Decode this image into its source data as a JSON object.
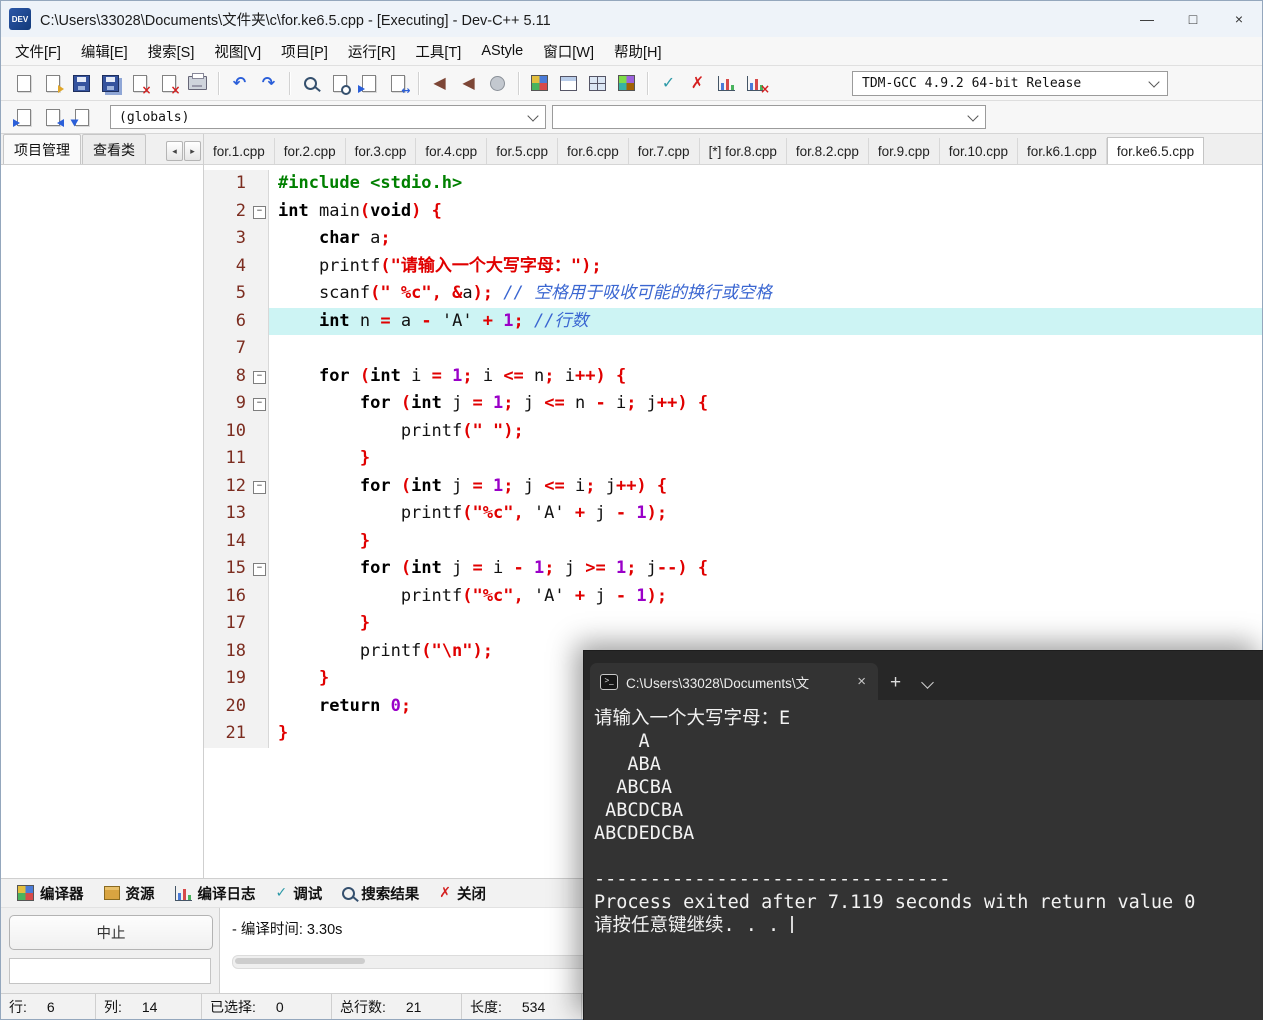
{
  "window": {
    "title": "C:\\Users\\33028\\Documents\\文件夹\\c\\for.ke6.5.cpp - [Executing] - Dev-C++ 5.11",
    "logo": "DEV",
    "min": "—",
    "max": "□",
    "close": "×"
  },
  "menu": {
    "items": [
      {
        "id": "file",
        "label": "文件[F]"
      },
      {
        "id": "edit",
        "label": "编辑[E]"
      },
      {
        "id": "search",
        "label": "搜索[S]"
      },
      {
        "id": "view",
        "label": "视图[V]"
      },
      {
        "id": "project",
        "label": "项目[P]"
      },
      {
        "id": "execute",
        "label": "运行[R]"
      },
      {
        "id": "tools",
        "label": "工具[T]"
      },
      {
        "id": "astyle",
        "label": "AStyle"
      },
      {
        "id": "window",
        "label": "窗口[W]"
      },
      {
        "id": "help",
        "label": "帮助[H]"
      }
    ]
  },
  "toolbar": {
    "compiler": "TDM-GCC 4.9.2 64-bit Release",
    "buttons": [
      {
        "name": "new-file",
        "icon": "new"
      },
      {
        "name": "open-file",
        "icon": "open"
      },
      {
        "name": "save",
        "icon": "save"
      },
      {
        "name": "save-all",
        "icon": "saveall"
      },
      {
        "name": "close-file",
        "icon": "close"
      },
      {
        "name": "close-all",
        "icon": "closeall"
      },
      {
        "name": "print",
        "icon": "print"
      },
      {
        "sep": true
      },
      {
        "name": "undo",
        "icon": "undo"
      },
      {
        "name": "redo",
        "icon": "redo"
      },
      {
        "sep": true
      },
      {
        "name": "find",
        "icon": "find"
      },
      {
        "name": "find-in-files",
        "icon": "findfiles"
      },
      {
        "name": "goto-line",
        "icon": "goto"
      },
      {
        "name": "replace",
        "icon": "replace"
      },
      {
        "sep": true
      },
      {
        "name": "compile",
        "icon": "compile"
      },
      {
        "name": "run",
        "icon": "run"
      },
      {
        "name": "profile",
        "icon": "pause"
      },
      {
        "sep": true
      },
      {
        "name": "new-project",
        "icon": "gridcolor"
      },
      {
        "name": "window-layout",
        "icon": "windowoutline"
      },
      {
        "name": "split-view",
        "icon": "gridpanes"
      },
      {
        "name": "project-options",
        "icon": "gridcolor2"
      },
      {
        "sep": true
      },
      {
        "name": "syntax-check",
        "icon": "check"
      },
      {
        "name": "abort-compile",
        "icon": "cross"
      },
      {
        "name": "profile-analysis",
        "icon": "chart"
      },
      {
        "name": "delete-profile",
        "icon": "chartx"
      }
    ]
  },
  "navbar": {
    "buttons": [
      {
        "name": "nav-back",
        "icon": "navback"
      },
      {
        "name": "nav-forward",
        "icon": "navforward"
      },
      {
        "name": "nav-goto",
        "icon": "navgoto"
      }
    ],
    "globals": "(globals)",
    "members": ""
  },
  "left_panel": {
    "tabs": [
      {
        "id": "project-manager",
        "label": "项目管理",
        "active": true
      },
      {
        "id": "class-viewer",
        "label": "查看类",
        "active": false
      }
    ],
    "scroll_left": "◂",
    "scroll_right": "▸"
  },
  "doc_tabs": {
    "active": "for.ke6.5.cpp",
    "tabs": [
      "for.1.cpp",
      "for.2.cpp",
      "for.3.cpp",
      "for.4.cpp",
      "for.5.cpp",
      "for.6.cpp",
      "for.7.cpp",
      "[*] for.8.cpp",
      "for.8.2.cpp",
      "for.9.cpp",
      "for.10.cpp",
      "for.k6.1.cpp",
      "for.ke6.5.cpp"
    ]
  },
  "editor": {
    "lines": [
      {
        "tokens": [
          [
            "p",
            "#include <stdio.h>"
          ]
        ]
      },
      {
        "fold": true,
        "tokens": [
          [
            "k",
            "int"
          ],
          [
            "",
            " main"
          ],
          [
            "o",
            "("
          ],
          [
            "k",
            "void"
          ],
          [
            "o",
            ")"
          ],
          [
            "",
            " "
          ],
          [
            "o",
            "{"
          ]
        ]
      },
      {
        "tokens": [
          [
            "",
            "    "
          ],
          [
            "k",
            "char"
          ],
          [
            "",
            " a"
          ],
          [
            "o",
            ";"
          ]
        ]
      },
      {
        "tokens": [
          [
            "",
            "    printf"
          ],
          [
            "o",
            "("
          ],
          [
            "s",
            "\"请输入一个大写字母：\""
          ],
          [
            "o",
            ");"
          ]
        ]
      },
      {
        "tokens": [
          [
            "",
            "    scanf"
          ],
          [
            "o",
            "("
          ],
          [
            "s",
            "\" %c\""
          ],
          [
            "o",
            ","
          ],
          [
            "",
            " "
          ],
          [
            "o",
            "&"
          ],
          [
            "",
            "a"
          ],
          [
            "o",
            ");"
          ],
          [
            "c",
            " // 空格用于吸收可能的换行或空格"
          ]
        ]
      },
      {
        "highlight": true,
        "tokens": [
          [
            "",
            "    "
          ],
          [
            "k",
            "int"
          ],
          [
            "",
            " n "
          ],
          [
            "o",
            "="
          ],
          [
            "",
            " a "
          ],
          [
            "o",
            "-"
          ],
          [
            "",
            " 'A' "
          ],
          [
            "o",
            "+"
          ],
          [
            "n",
            " 1"
          ],
          [
            "o",
            ";"
          ],
          [
            "c",
            " //行数"
          ]
        ]
      },
      {
        "tokens": []
      },
      {
        "fold": true,
        "tokens": [
          [
            "",
            "    "
          ],
          [
            "k",
            "for"
          ],
          [
            "",
            " "
          ],
          [
            "o",
            "("
          ],
          [
            "k",
            "int"
          ],
          [
            "",
            " i "
          ],
          [
            "o",
            "="
          ],
          [
            "n",
            " 1"
          ],
          [
            "o",
            ";"
          ],
          [
            "",
            " i "
          ],
          [
            "o",
            "<="
          ],
          [
            "",
            " n"
          ],
          [
            "o",
            ";"
          ],
          [
            "",
            " i"
          ],
          [
            "o",
            "++)"
          ],
          [
            "",
            " "
          ],
          [
            "o",
            "{"
          ]
        ]
      },
      {
        "fold": true,
        "tokens": [
          [
            "",
            "        "
          ],
          [
            "k",
            "for"
          ],
          [
            "",
            " "
          ],
          [
            "o",
            "("
          ],
          [
            "k",
            "int"
          ],
          [
            "",
            " j "
          ],
          [
            "o",
            "="
          ],
          [
            "n",
            " 1"
          ],
          [
            "o",
            ";"
          ],
          [
            "",
            " j "
          ],
          [
            "o",
            "<="
          ],
          [
            "",
            " n "
          ],
          [
            "o",
            "-"
          ],
          [
            "",
            " i"
          ],
          [
            "o",
            ";"
          ],
          [
            "",
            " j"
          ],
          [
            "o",
            "++)"
          ],
          [
            "",
            " "
          ],
          [
            "o",
            "{"
          ]
        ]
      },
      {
        "tokens": [
          [
            "",
            "            printf"
          ],
          [
            "o",
            "("
          ],
          [
            "s",
            "\" \""
          ],
          [
            "o",
            ");"
          ]
        ]
      },
      {
        "tokens": [
          [
            "",
            "        "
          ],
          [
            "o",
            "}"
          ]
        ]
      },
      {
        "fold": true,
        "tokens": [
          [
            "",
            "        "
          ],
          [
            "k",
            "for"
          ],
          [
            "",
            " "
          ],
          [
            "o",
            "("
          ],
          [
            "k",
            "int"
          ],
          [
            "",
            " j "
          ],
          [
            "o",
            "="
          ],
          [
            "n",
            " 1"
          ],
          [
            "o",
            ";"
          ],
          [
            "",
            " j "
          ],
          [
            "o",
            "<="
          ],
          [
            "",
            " i"
          ],
          [
            "o",
            ";"
          ],
          [
            "",
            " j"
          ],
          [
            "o",
            "++)"
          ],
          [
            "",
            " "
          ],
          [
            "o",
            "{"
          ]
        ]
      },
      {
        "tokens": [
          [
            "",
            "            printf"
          ],
          [
            "o",
            "("
          ],
          [
            "s",
            "\"%c\""
          ],
          [
            "o",
            ","
          ],
          [
            "",
            " 'A' "
          ],
          [
            "o",
            "+"
          ],
          [
            "",
            " j "
          ],
          [
            "o",
            "-"
          ],
          [
            "n",
            " 1"
          ],
          [
            "o",
            ");"
          ]
        ]
      },
      {
        "tokens": [
          [
            "",
            "        "
          ],
          [
            "o",
            "}"
          ]
        ]
      },
      {
        "fold": true,
        "tokens": [
          [
            "",
            "        "
          ],
          [
            "k",
            "for"
          ],
          [
            "",
            " "
          ],
          [
            "o",
            "("
          ],
          [
            "k",
            "int"
          ],
          [
            "",
            " j "
          ],
          [
            "o",
            "="
          ],
          [
            "",
            " i "
          ],
          [
            "o",
            "-"
          ],
          [
            "n",
            " 1"
          ],
          [
            "o",
            ";"
          ],
          [
            "",
            " j "
          ],
          [
            "o",
            ">="
          ],
          [
            "n",
            " 1"
          ],
          [
            "o",
            ";"
          ],
          [
            "",
            " j"
          ],
          [
            "o",
            "--)"
          ],
          [
            "",
            " "
          ],
          [
            "o",
            "{"
          ]
        ]
      },
      {
        "tokens": [
          [
            "",
            "            printf"
          ],
          [
            "o",
            "("
          ],
          [
            "s",
            "\"%c\""
          ],
          [
            "o",
            ","
          ],
          [
            "",
            " 'A' "
          ],
          [
            "o",
            "+"
          ],
          [
            "",
            " j "
          ],
          [
            "o",
            "-"
          ],
          [
            "n",
            " 1"
          ],
          [
            "o",
            ");"
          ]
        ]
      },
      {
        "tokens": [
          [
            "",
            "        "
          ],
          [
            "o",
            "}"
          ]
        ]
      },
      {
        "tokens": [
          [
            "",
            "        printf"
          ],
          [
            "o",
            "("
          ],
          [
            "s",
            "\"\\n\""
          ],
          [
            "o",
            ");"
          ]
        ]
      },
      {
        "tokens": [
          [
            "",
            "    "
          ],
          [
            "o",
            "}"
          ]
        ]
      },
      {
        "tokens": [
          [
            "",
            "    "
          ],
          [
            "k",
            "return"
          ],
          [
            "n",
            " 0"
          ],
          [
            "o",
            ";"
          ]
        ]
      },
      {
        "tokens": [
          [
            "o",
            "}"
          ]
        ]
      }
    ]
  },
  "bottom_panel": {
    "tabs": [
      {
        "id": "compiler",
        "label": "编译器",
        "icon": "gridcolor"
      },
      {
        "id": "resources",
        "label": "资源",
        "icon": "box"
      },
      {
        "id": "compile-log",
        "label": "编译日志",
        "icon": "chart"
      },
      {
        "id": "debug",
        "label": "调试",
        "icon": "check"
      },
      {
        "id": "search-results",
        "label": "搜索结果",
        "icon": "find"
      },
      {
        "id": "close",
        "label": "关闭",
        "icon": "cross"
      }
    ],
    "abort_label": "中止",
    "compile_time": "- 编译时间: 3.30s"
  },
  "statusbar": {
    "segments": [
      {
        "id": "line",
        "label": "行:",
        "value": "6"
      },
      {
        "id": "col",
        "label": "列:",
        "value": "14"
      },
      {
        "id": "selected",
        "label": "已选择:",
        "value": "0"
      },
      {
        "id": "total-lines",
        "label": "总行数:",
        "value": "21"
      },
      {
        "id": "length",
        "label": "长度:",
        "value": "534"
      }
    ]
  },
  "console": {
    "tab_title": "C:\\Users\\33028\\Documents\\文",
    "tab_icon_glyph": ">_",
    "close": "×",
    "new_tab": "+",
    "lines": [
      "请输入一个大写字母：E",
      "    A",
      "   ABA",
      "  ABCBA",
      " ABCDCBA",
      "ABCDEDCBA",
      "",
      "--------------------------------",
      "Process exited after 7.119 seconds with return value 0",
      "请按任意键继续. . . "
    ]
  }
}
